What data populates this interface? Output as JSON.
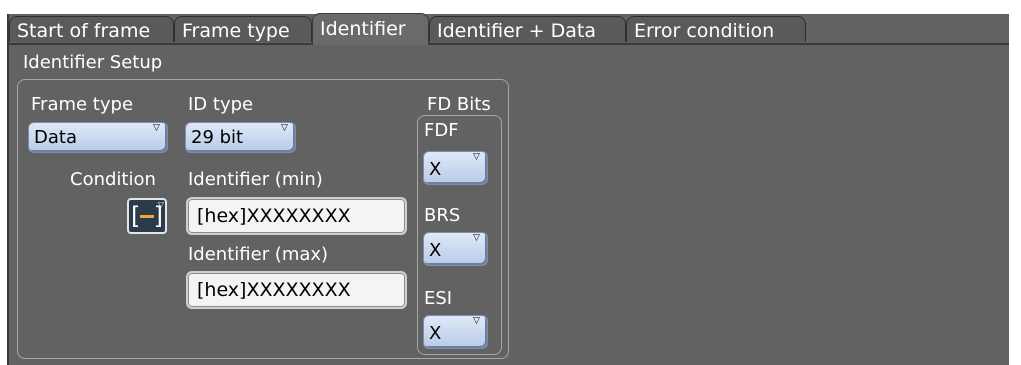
{
  "tabs": [
    {
      "label": "Start of frame"
    },
    {
      "label": "Frame type"
    },
    {
      "label": "Identifier"
    },
    {
      "label": "Identifier + Data"
    },
    {
      "label": "Error condition"
    }
  ],
  "active_tab": "Identifier",
  "section_title": "Identifier Setup",
  "frame_type": {
    "label": "Frame type",
    "value": "Data"
  },
  "id_type": {
    "label": "ID type",
    "value": "29 bit"
  },
  "condition": {
    "label": "Condition"
  },
  "identifier_min": {
    "label": "Identifier (min)",
    "value": "[hex]XXXXXXXX"
  },
  "identifier_max": {
    "label": "Identifier (max)",
    "value": "[hex]XXXXXXXX"
  },
  "fd_bits": {
    "title": "FD Bits",
    "fdf": {
      "label": "FDF",
      "value": "X"
    },
    "brs": {
      "label": "BRS",
      "value": "X"
    },
    "esi": {
      "label": "ESI",
      "value": "X"
    }
  },
  "colors": {
    "panel": "#626262",
    "dropdown": "#c6d6ee",
    "accent": "#f2a23a"
  },
  "icons": {
    "dropdown_arrow": "triangle-down",
    "condition": "range-bracket"
  }
}
